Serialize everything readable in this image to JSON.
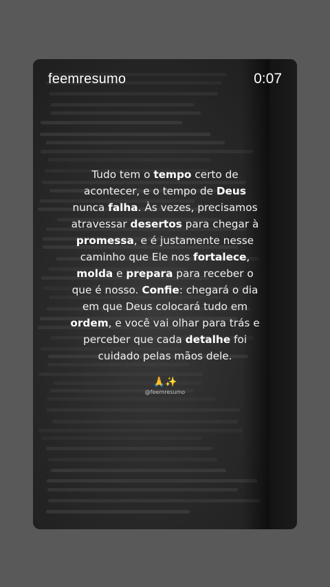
{
  "header": {
    "username": "feemresumo",
    "time": "0:07"
  },
  "post": {
    "lines": [
      [
        {
          "t": "Tudo tem o ",
          "b": false
        },
        {
          "t": "tempo",
          "b": true
        },
        {
          "t": " certo de",
          "b": false
        }
      ],
      [
        {
          "t": "acontecer, e o tempo de ",
          "b": false
        },
        {
          "t": "Deus",
          "b": true
        }
      ],
      [
        {
          "t": "nunca ",
          "b": false
        },
        {
          "t": "falha",
          "b": true
        },
        {
          "t": ". Às vezes, precisamos",
          "b": false
        }
      ],
      [
        {
          "t": "atravessar ",
          "b": false
        },
        {
          "t": "desertos",
          "b": true
        },
        {
          "t": " para chegar à",
          "b": false
        }
      ],
      [
        {
          "t": "promessa",
          "b": true
        },
        {
          "t": ", e é justamente nesse",
          "b": false
        }
      ],
      [
        {
          "t": "caminho que Ele nos ",
          "b": false
        },
        {
          "t": "fortalece",
          "b": true
        },
        {
          "t": ",",
          "b": false
        }
      ],
      [
        {
          "t": "molda",
          "b": true
        },
        {
          "t": " e ",
          "b": false
        },
        {
          "t": "prepara",
          "b": true
        },
        {
          "t": " para receber o",
          "b": false
        }
      ],
      [
        {
          "t": "que é nosso. ",
          "b": false
        },
        {
          "t": "Confie",
          "b": true
        },
        {
          "t": ": chegará o dia",
          "b": false
        }
      ],
      [
        {
          "t": "em que Deus colocará tudo em",
          "b": false
        }
      ],
      [
        {
          "t": "ordem",
          "b": true
        },
        {
          "t": ", e você vai olhar para trás e",
          "b": false
        }
      ],
      [
        {
          "t": "perceber que cada ",
          "b": false
        },
        {
          "t": "detalhe",
          "b": true
        },
        {
          "t": " foi",
          "b": false
        }
      ],
      [
        {
          "t": "cuidado pelas mãos dele.",
          "b": false
        }
      ]
    ],
    "emoji_hands": "🙏",
    "emoji_sparkles": "✨",
    "handle": "@feemresumo"
  },
  "colors": {
    "background": "#595959",
    "text": "#f2f2f2"
  }
}
